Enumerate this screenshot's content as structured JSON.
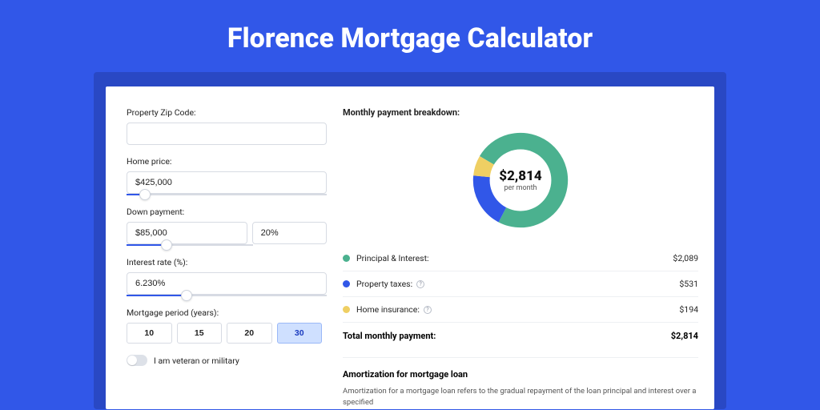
{
  "title": "Florence Mortgage Calculator",
  "form": {
    "zip": {
      "label": "Property Zip Code:",
      "value": ""
    },
    "home_price": {
      "label": "Home price:",
      "value": "$425,000",
      "slider_pct": 9
    },
    "down_payment": {
      "label": "Down payment:",
      "value_amount": "$85,000",
      "value_pct": "20%",
      "slider_pct": 20
    },
    "interest": {
      "label": "Interest rate (%):",
      "value": "6.230%",
      "slider_pct": 30
    },
    "period": {
      "label": "Mortgage period (years):",
      "options": [
        "10",
        "15",
        "20",
        "30"
      ],
      "selected": "30"
    },
    "veteran": {
      "label": "I am veteran or military",
      "on": false
    }
  },
  "breakdown": {
    "title": "Monthly payment breakdown:",
    "center_amount": "$2,814",
    "center_sub": "per month",
    "items": [
      {
        "label": "Principal & Interest:",
        "value": "$2,089",
        "color": "#4bb18f",
        "info": false
      },
      {
        "label": "Property taxes:",
        "value": "$531",
        "color": "#3157e8",
        "info": true
      },
      {
        "label": "Home insurance:",
        "value": "$194",
        "color": "#efcf63",
        "info": true
      }
    ],
    "total": {
      "label": "Total monthly payment:",
      "value": "$2,814"
    }
  },
  "chart_data": {
    "type": "pie",
    "title": "Monthly payment breakdown",
    "series": [
      {
        "name": "Principal & Interest",
        "value": 2089,
        "color": "#4bb18f"
      },
      {
        "name": "Property taxes",
        "value": 531,
        "color": "#3157e8"
      },
      {
        "name": "Home insurance",
        "value": 194,
        "color": "#efcf63"
      }
    ],
    "total": 2814,
    "center_label": "$2,814 per month"
  },
  "amortization": {
    "title": "Amortization for mortgage loan",
    "body": "Amortization for a mortgage loan refers to the gradual repayment of the loan principal and interest over a specified"
  }
}
